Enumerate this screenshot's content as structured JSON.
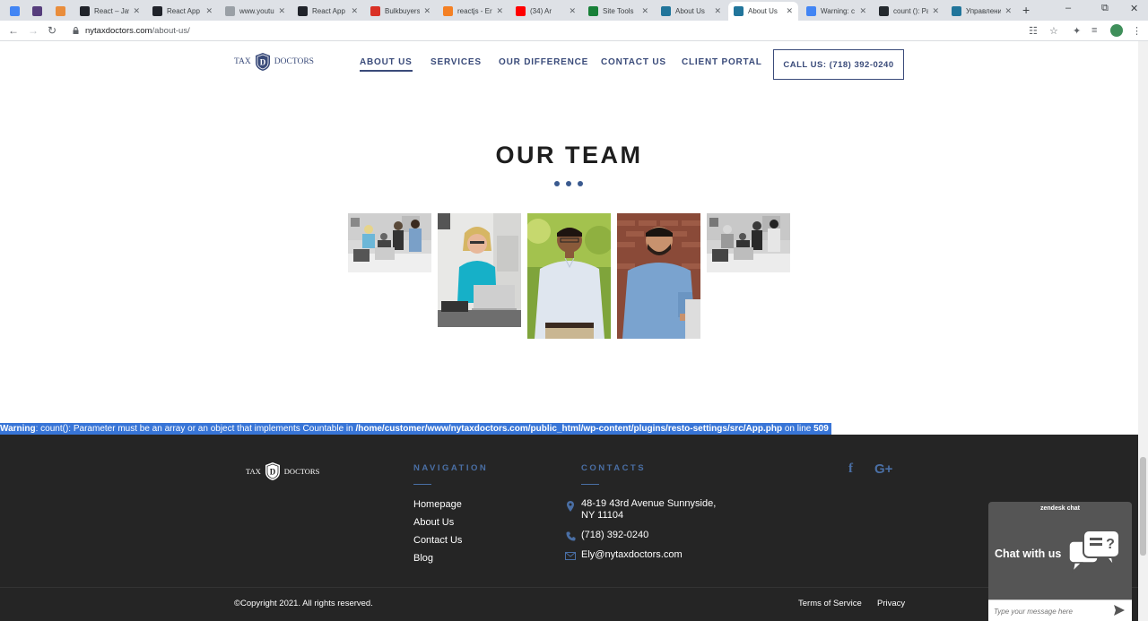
{
  "browser": {
    "tabs": [
      {
        "label": "",
        "favicon": "google-docs-icon",
        "color": "#4285f4"
      },
      {
        "label": "",
        "favicon": "bootstrap-icon",
        "color": "#563d7c"
      },
      {
        "label": "",
        "favicon": "h-icon",
        "color": "#e98d3c"
      },
      {
        "label": "React – Jav",
        "favicon": "react-icon",
        "color": "#20232a"
      },
      {
        "label": "React App",
        "favicon": "react-icon",
        "color": "#20232a"
      },
      {
        "label": "www.youtu",
        "favicon": "globe-icon",
        "color": "#9aa0a6"
      },
      {
        "label": "React App",
        "favicon": "react-icon",
        "color": "#20232a"
      },
      {
        "label": "Bulkbuyers",
        "favicon": "bulkbuyers-icon",
        "color": "#d93025"
      },
      {
        "label": "reactjs - Err",
        "favicon": "stackoverflow-icon",
        "color": "#f48024"
      },
      {
        "label": "(34) Ar",
        "favicon": "youtube-icon",
        "color": "#ff0000"
      },
      {
        "label": "Site Tools",
        "favicon": "sitetools-icon",
        "color": "#188038"
      },
      {
        "label": "About Us",
        "favicon": "wordpress-icon",
        "color": "#21759b"
      },
      {
        "label": "About Us",
        "favicon": "wordpress-icon",
        "color": "#21759b"
      },
      {
        "label": "Warning: c",
        "favicon": "google-icon",
        "color": "#4285f4"
      },
      {
        "label": "count (): Pa",
        "favicon": "github-icon",
        "color": "#24292e"
      },
      {
        "label": "Управлени",
        "favicon": "wordpress-icon",
        "color": "#21759b"
      }
    ],
    "active_tab_index": 12,
    "url_host": "nytaxdoctors.com",
    "url_path": "/about-us/"
  },
  "header": {
    "logo_left": "TAX",
    "logo_right": "DOCTORS",
    "nav": [
      {
        "label": "ABOUT US",
        "active": true
      },
      {
        "label": "SERVICES",
        "active": false
      },
      {
        "label": "OUR DIFFERENCE",
        "active": false
      },
      {
        "label": "CONTACT US",
        "active": false
      },
      {
        "label": "CLIENT PORTAL",
        "active": false
      }
    ],
    "call_button": "CALL US: (718) 392-0240"
  },
  "team": {
    "title": "OUR TEAM",
    "photos": [
      {
        "name": "team-photo-group-1"
      },
      {
        "name": "team-photo-woman-desk"
      },
      {
        "name": "team-photo-man-glasses"
      },
      {
        "name": "team-photo-man-beard"
      },
      {
        "name": "team-photo-group-2"
      }
    ]
  },
  "warning": {
    "label": "Warning",
    "message": ": count(): Parameter must be an array or an object that implements Countable in ",
    "path": "/home/customer/www/nytaxdoctors.com/public_html/wp-content/plugins/resto-settings/src/App.php",
    "on_line": " on line ",
    "line": "509"
  },
  "footer": {
    "logo_left": "TAX",
    "logo_right": "DOCTORS",
    "nav_heading": "NAVIGATION",
    "nav_links": [
      "Homepage",
      "About Us",
      "Contact Us",
      "Blog"
    ],
    "contacts_heading": "CONTACTS",
    "address_line1": "48-19 43rd Avenue Sunnyside,",
    "address_line2": "NY 11104",
    "phone": "(718) 392-0240",
    "email": "Ely@nytaxdoctors.com",
    "social": [
      "facebook-icon",
      "google-plus-icon"
    ],
    "copyright": "©Copyright 2021. All rights reserved.",
    "terms": "Terms of Service",
    "privacy": "Privacy"
  },
  "zendesk": {
    "brand": "zendesk chat",
    "cta": "Chat with us",
    "placeholder": "Type your message here"
  },
  "colors": {
    "brand_navy": "#3a4b7a",
    "accent_blue": "#4a6fa5",
    "footer_bg": "#252525",
    "warning_highlight": "#3875d7"
  }
}
